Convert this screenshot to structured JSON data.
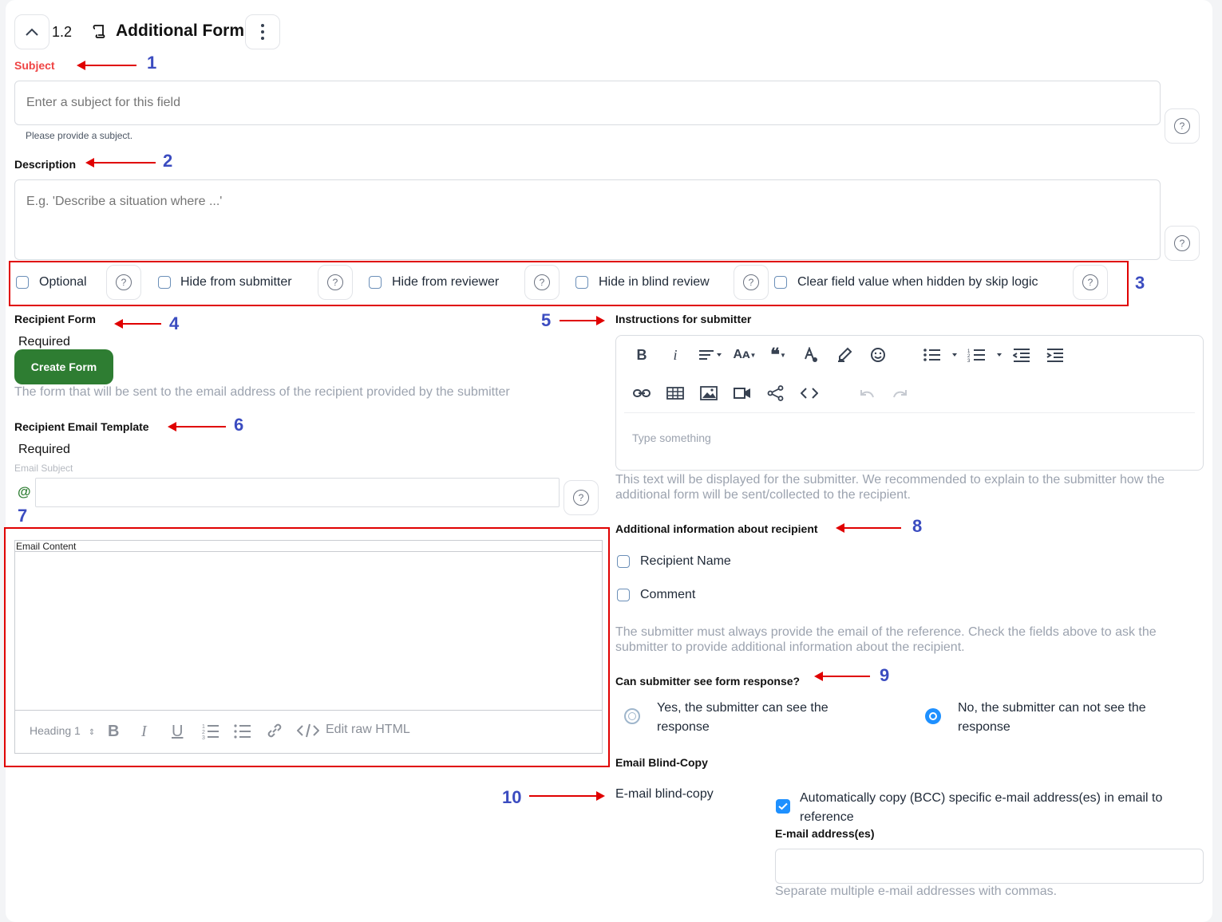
{
  "header": {
    "section_number": "1.2",
    "title": "Additional Form"
  },
  "subject": {
    "label": "Subject",
    "placeholder": "Enter a subject for this field",
    "error": "Please provide a subject."
  },
  "description": {
    "label": "Description",
    "placeholder": "E.g. 'Describe a situation where ...'"
  },
  "options": [
    {
      "label": "Optional",
      "checked": false
    },
    {
      "label": "Hide from submitter",
      "checked": false
    },
    {
      "label": "Hide from reviewer",
      "checked": false
    },
    {
      "label": "Hide in blind review",
      "checked": false
    },
    {
      "label": "Clear field value when hidden by skip logic",
      "checked": false
    }
  ],
  "recipient_form": {
    "label": "Recipient Form",
    "required": "Required",
    "button": "Create Form",
    "hint": "The form that will be sent to the email address of the recipient provided by the submitter"
  },
  "email_template": {
    "label": "Recipient Email Template",
    "required": "Required",
    "subject_label": "Email Subject",
    "at_symbol": "@",
    "content_label": "Email Content",
    "toolbar": {
      "heading": "Heading 1",
      "edit_raw": "Edit raw HTML"
    }
  },
  "instructions": {
    "label": "Instructions for submitter",
    "placeholder": "Type something",
    "hint": "This text will be displayed for the submitter. We recommended to explain to the submitter how the additional form will be sent/collected to the recipient."
  },
  "additional_info": {
    "label": "Additional information about recipient",
    "options": [
      "Recipient Name",
      "Comment"
    ],
    "hint": "The submitter must always provide the email of the reference. Check the fields above to ask the submitter to provide additional information about the recipient."
  },
  "response_visibility": {
    "label": "Can submitter see form response?",
    "yes": "Yes, the submitter can see the response",
    "no": "No, the submitter can not see the response",
    "selected": "no"
  },
  "bcc": {
    "section_label": "Email Blind-Copy",
    "row_label": "E-mail blind-copy",
    "checkbox_label": "Automatically copy (BCC) specific e-mail address(es) in email to reference",
    "checked": true,
    "addresses_label": "E-mail address(es)",
    "addresses_value": "",
    "hint": "Separate multiple e-mail addresses with commas."
  },
  "annotations": [
    "1",
    "2",
    "3",
    "4",
    "5",
    "6",
    "7",
    "8",
    "9",
    "10"
  ],
  "colors": {
    "accent_green": "#2e7d32",
    "error_red": "#ef4444",
    "annotation_red": "#e00000",
    "annotation_blue": "#3b4cc0",
    "checkbox_blue": "#1e90ff"
  }
}
